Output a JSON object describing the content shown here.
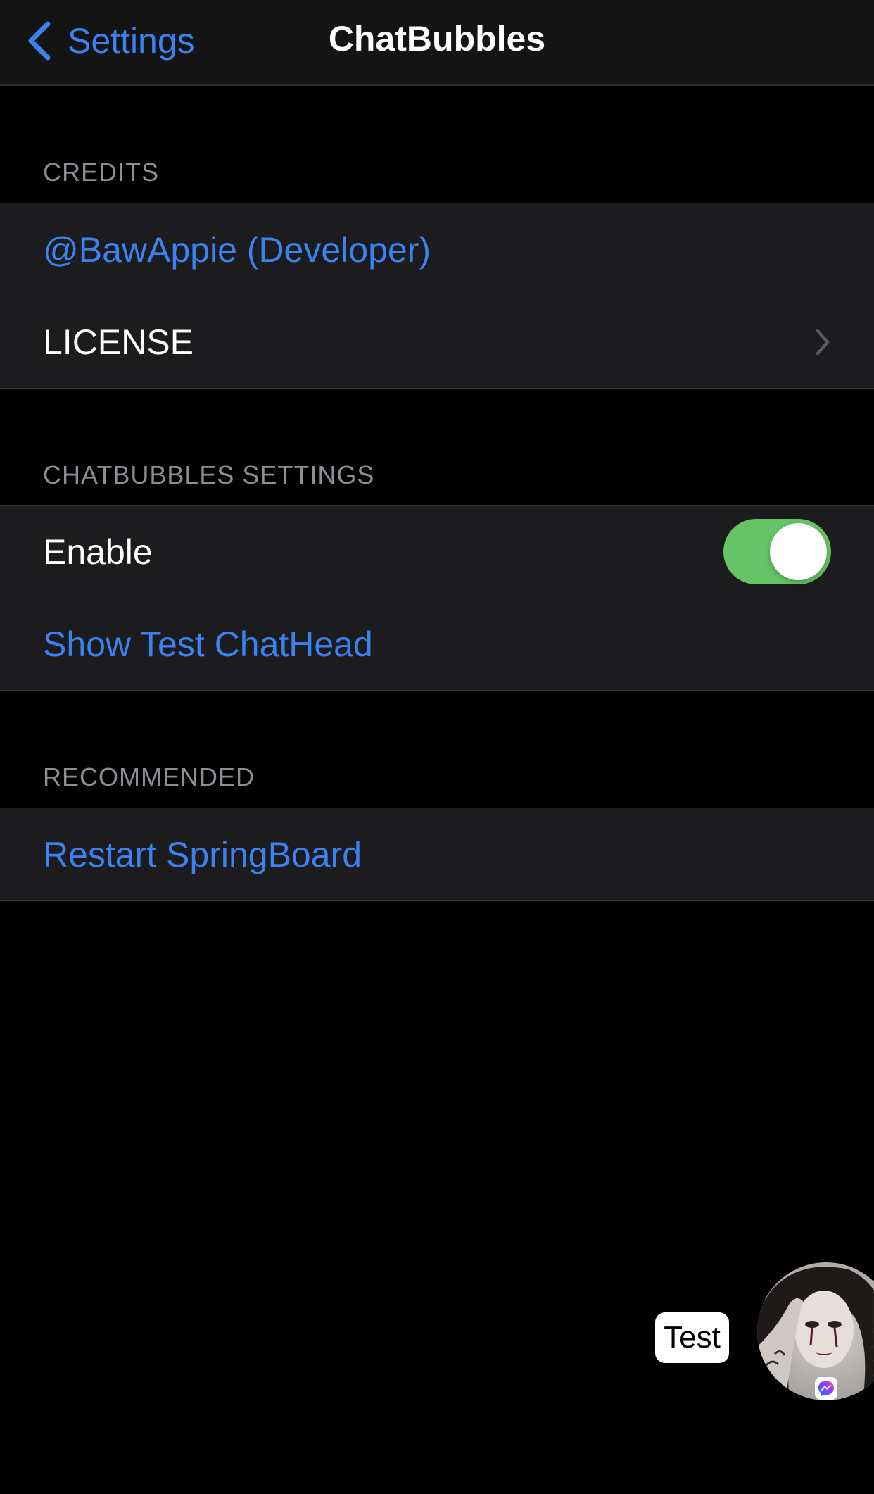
{
  "nav": {
    "back_label": "Settings",
    "title": "ChatBubbles"
  },
  "sections": {
    "credits": {
      "header": "CREDITS",
      "developer_label": "@BawAppie (Developer)",
      "license_label": "LICENSE"
    },
    "settings": {
      "header": "CHATBUBBLES SETTINGS",
      "enable_label": "Enable",
      "enable_on": true,
      "show_test_label": "Show Test ChatHead"
    },
    "recommended": {
      "header": "RECOMMENDED",
      "restart_label": "Restart SpringBoard"
    }
  },
  "chathead": {
    "bubble_text": "Test",
    "badge_icon": "messenger-icon"
  },
  "colors": {
    "accent": "#3b82f0",
    "toggle_on": "#65c466",
    "background": "#000000",
    "cell_background": "#1c1c1e",
    "section_header": "#8d8d93"
  }
}
